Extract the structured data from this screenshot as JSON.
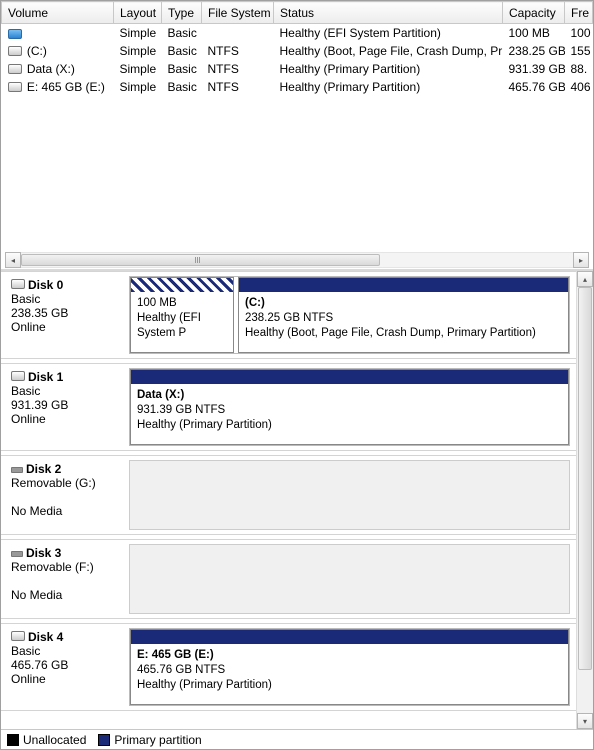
{
  "columns": {
    "volume": "Volume",
    "layout": "Layout",
    "type": "Type",
    "filesystem": "File System",
    "status": "Status",
    "capacity": "Capacity",
    "free": "Fre"
  },
  "volumes": [
    {
      "name": "",
      "layout": "Simple",
      "type": "Basic",
      "fs": "",
      "status": "Healthy (EFI System Partition)",
      "capacity": "100 MB",
      "free": "100"
    },
    {
      "name": "(C:)",
      "layout": "Simple",
      "type": "Basic",
      "fs": "NTFS",
      "status": "Healthy (Boot, Page File, Crash Dump, Primary Partition)",
      "capacity": "238.25 GB",
      "free": "155"
    },
    {
      "name": "Data (X:)",
      "layout": "Simple",
      "type": "Basic",
      "fs": "NTFS",
      "status": "Healthy (Primary Partition)",
      "capacity": "931.39 GB",
      "free": "88."
    },
    {
      "name": "E: 465 GB (E:)",
      "layout": "Simple",
      "type": "Basic",
      "fs": "NTFS",
      "status": "Healthy (Primary Partition)",
      "capacity": "465.76 GB",
      "free": "406"
    }
  ],
  "disks": {
    "d0": {
      "name": "Disk 0",
      "type": "Basic",
      "size": "238.35 GB",
      "state": "Online",
      "p0": {
        "name": "",
        "size": "100 MB",
        "status": "Healthy (EFI System P"
      },
      "p1": {
        "name": "(C:)",
        "size": "238.25 GB NTFS",
        "status": "Healthy (Boot, Page File, Crash Dump, Primary Partition)"
      }
    },
    "d1": {
      "name": "Disk 1",
      "type": "Basic",
      "size": "931.39 GB",
      "state": "Online",
      "p0": {
        "name": "Data  (X:)",
        "size": "931.39 GB NTFS",
        "status": "Healthy (Primary Partition)"
      }
    },
    "d2": {
      "name": "Disk 2",
      "type": "Removable (G:)",
      "state": "No Media"
    },
    "d3": {
      "name": "Disk 3",
      "type": "Removable (F:)",
      "state": "No Media"
    },
    "d4": {
      "name": "Disk 4",
      "type": "Basic",
      "size": "465.76 GB",
      "state": "Online",
      "p0": {
        "name": "E: 465 GB  (E:)",
        "size": "465.76 GB NTFS",
        "status": "Healthy (Primary Partition)"
      }
    }
  },
  "legend": {
    "unallocated": "Unallocated",
    "primary": "Primary partition"
  }
}
